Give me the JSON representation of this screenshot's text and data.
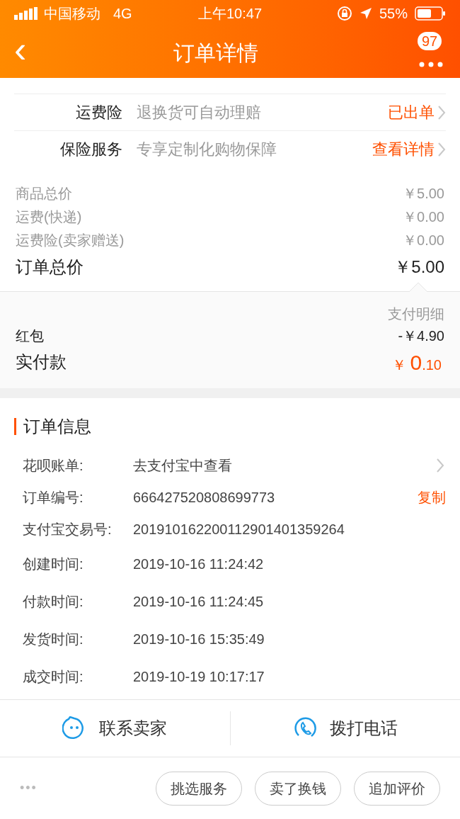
{
  "status_bar": {
    "carrier": "中国移动",
    "network": "4G",
    "time": "上午10:47",
    "battery": "55%"
  },
  "nav": {
    "back": "‹",
    "title": "订单详情",
    "badge": "97"
  },
  "services": [
    {
      "label": "运费险",
      "desc": "退换货可自动理赔",
      "action": "已出单"
    },
    {
      "label": "保险服务",
      "desc": "专享定制化购物保障",
      "action": "查看详情"
    }
  ],
  "prices": [
    {
      "label": "商品总价",
      "value": "￥5.00",
      "kind": "minor"
    },
    {
      "label": "运费(快递)",
      "value": "￥0.00",
      "kind": "minor"
    },
    {
      "label": "运费险(卖家赠送)",
      "value": "￥0.00",
      "kind": "minor"
    },
    {
      "label": "订单总价",
      "value": "￥5.00",
      "kind": "total"
    }
  ],
  "payment": {
    "detail_link": "支付明细",
    "red_packet_label": "红包",
    "red_packet_value": "-￥4.90",
    "paid_label": "实付款",
    "paid_currency": "￥",
    "paid_int": "0",
    "paid_dec": ".10"
  },
  "order_info": {
    "title": "订单信息",
    "rows": [
      {
        "label": "花呗账单:",
        "value": "去支付宝中查看",
        "kind": "link"
      },
      {
        "label": "订单编号:",
        "value": "666427520808699773",
        "kind": "copy",
        "action": "复制"
      },
      {
        "label": "支付宝交易号:",
        "value": "201910162200112901401359264",
        "kind": "plain"
      },
      {
        "label": "创建时间:",
        "value": "2019-10-16 11:24:42",
        "kind": "plain"
      },
      {
        "label": "付款时间:",
        "value": "2019-10-16 11:24:45",
        "kind": "plain"
      },
      {
        "label": "发货时间:",
        "value": "2019-10-16 15:35:49",
        "kind": "plain"
      },
      {
        "label": "成交时间:",
        "value": "2019-10-19 10:17:17",
        "kind": "plain"
      }
    ]
  },
  "contact": [
    {
      "label": "联系卖家",
      "kind": "chat"
    },
    {
      "label": "拨打电话",
      "kind": "phone"
    }
  ],
  "bottom": {
    "more": "•••",
    "buttons": [
      "挑选服务",
      "卖了换钱",
      "追加评价"
    ]
  }
}
